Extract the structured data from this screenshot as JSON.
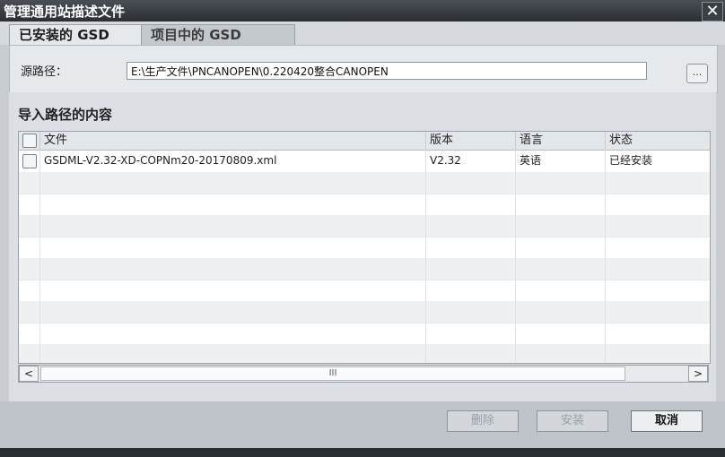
{
  "window": {
    "title": "管理通用站描述文件",
    "close": "✕"
  },
  "tabs": [
    "已安装的 GSD",
    "项目中的 GSD"
  ],
  "source_path": {
    "label": "源路径：",
    "value": "E:\\生产文件\\PNCANOPEN\\0.220420整合CANOPEN",
    "browse": "..."
  },
  "section_title": "导入路径的内容",
  "table": {
    "columns": [
      "文件",
      "版本",
      "语言",
      "状态"
    ],
    "rows": [
      {
        "file": "GSDML-V2.32-XD-COPNm20-20170809.xml",
        "version": "V2.32",
        "language": "英语",
        "status": "已经安装"
      }
    ]
  },
  "scrollbar": {
    "left": "<",
    "thumb": "III",
    "right": ">"
  },
  "buttons": {
    "delete": "删除",
    "install": "安装",
    "cancel": "取消"
  }
}
